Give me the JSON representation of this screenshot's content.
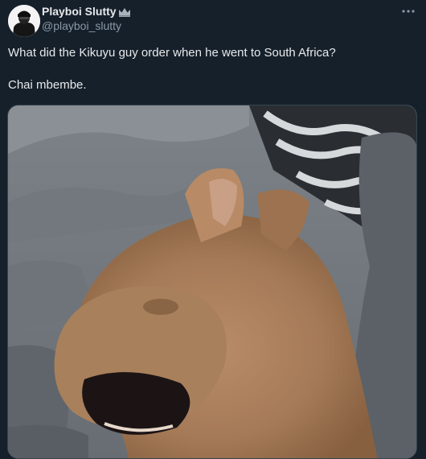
{
  "tweet": {
    "author": {
      "display_name": "Playboi Slutty",
      "name_emoji": "crown-icon",
      "handle": "@playboi_slutty",
      "avatar": "avatar-photo"
    },
    "more_icon": "more-horizontal-icon",
    "text_line1": "What did the Kikuyu guy order when he went to South Africa?",
    "text_line2": "Chai mbembe.",
    "media": {
      "type": "photo",
      "content": "dog-yawning-photo"
    }
  },
  "colors": {
    "background": "#15202b",
    "text_primary": "#e7e9ea",
    "text_secondary": "#8b98a5",
    "border": "#38444d"
  }
}
